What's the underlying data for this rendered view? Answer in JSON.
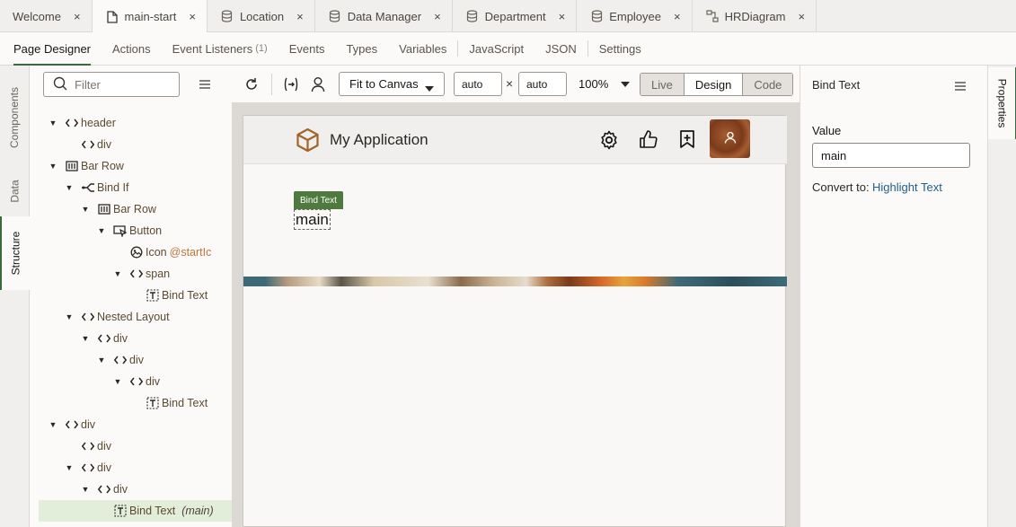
{
  "tabs": [
    {
      "label": "Welcome",
      "icon": "none",
      "active": false
    },
    {
      "label": "main-start",
      "icon": "page-icon",
      "active": true
    },
    {
      "label": "Location",
      "icon": "database-icon",
      "active": false
    },
    {
      "label": "Data Manager",
      "icon": "database-icon",
      "active": false
    },
    {
      "label": "Department",
      "icon": "database-icon",
      "active": false
    },
    {
      "label": "Employee",
      "icon": "database-icon",
      "active": false
    },
    {
      "label": "HRDiagram",
      "icon": "diagram-icon",
      "active": false
    }
  ],
  "close_glyph": "×",
  "subnav": {
    "page_designer": "Page Designer",
    "actions": "Actions",
    "event_listeners": "Event Listeners",
    "event_listeners_count": "(1)",
    "events": "Events",
    "types": "Types",
    "variables": "Variables",
    "javascript": "JavaScript",
    "json": "JSON",
    "settings": "Settings"
  },
  "left_strip": {
    "components": "Components",
    "data": "Data",
    "structure": "Structure"
  },
  "filter": {
    "placeholder": "Filter"
  },
  "tree": [
    {
      "label": "header",
      "icon": "code",
      "tw": "open"
    },
    {
      "label": "div",
      "icon": "code",
      "tw": "none"
    },
    {
      "label": "Bar Row",
      "icon": "barrow",
      "tw": "open"
    },
    {
      "label": "Bind If",
      "icon": "bindif",
      "tw": "open"
    },
    {
      "label": "Bar Row",
      "icon": "barrow",
      "tw": "open"
    },
    {
      "label": "Button",
      "icon": "button",
      "tw": "open"
    },
    {
      "label": "Icon",
      "icon": "icon",
      "tw": "none",
      "ext": "@startIc"
    },
    {
      "label": "span",
      "icon": "code",
      "tw": "open"
    },
    {
      "label": "Bind Text",
      "icon": "bindtext",
      "tw": "none"
    },
    {
      "label": "Nested Layout",
      "icon": "code",
      "tw": "open"
    },
    {
      "label": "div",
      "icon": "code",
      "tw": "open"
    },
    {
      "label": "div",
      "icon": "code",
      "tw": "open"
    },
    {
      "label": "div",
      "icon": "code",
      "tw": "open"
    },
    {
      "label": "Bind Text",
      "icon": "bindtext",
      "tw": "none"
    },
    {
      "label": "div",
      "icon": "code",
      "tw": "open"
    },
    {
      "label": "div",
      "icon": "code",
      "tw": "none"
    },
    {
      "label": "div",
      "icon": "code",
      "tw": "open"
    },
    {
      "label": "div",
      "icon": "code",
      "tw": "open"
    },
    {
      "label": "Bind Text",
      "icon": "bindtext",
      "tw": "none",
      "ext2": "(main)",
      "selected": true
    }
  ],
  "toolbar": {
    "fit": "Fit to Canvas",
    "width": "auto",
    "times": "×",
    "height": "auto",
    "zoom": "100%",
    "modes": [
      "Live",
      "Design",
      "Code"
    ],
    "active_mode": "Design"
  },
  "app": {
    "title": "My Application",
    "badge": "Bind Text",
    "text": "main"
  },
  "properties": {
    "title": "Bind Text",
    "value_label": "Value",
    "value": "main",
    "convert_label": "Convert to:",
    "convert_link": "Highlight Text"
  },
  "right_strip": {
    "properties": "Properties"
  },
  "colors": {
    "accent": "#3a6a3a",
    "badge": "#4e7a3e",
    "link": "#226089",
    "avatar": "#8a4a26"
  }
}
